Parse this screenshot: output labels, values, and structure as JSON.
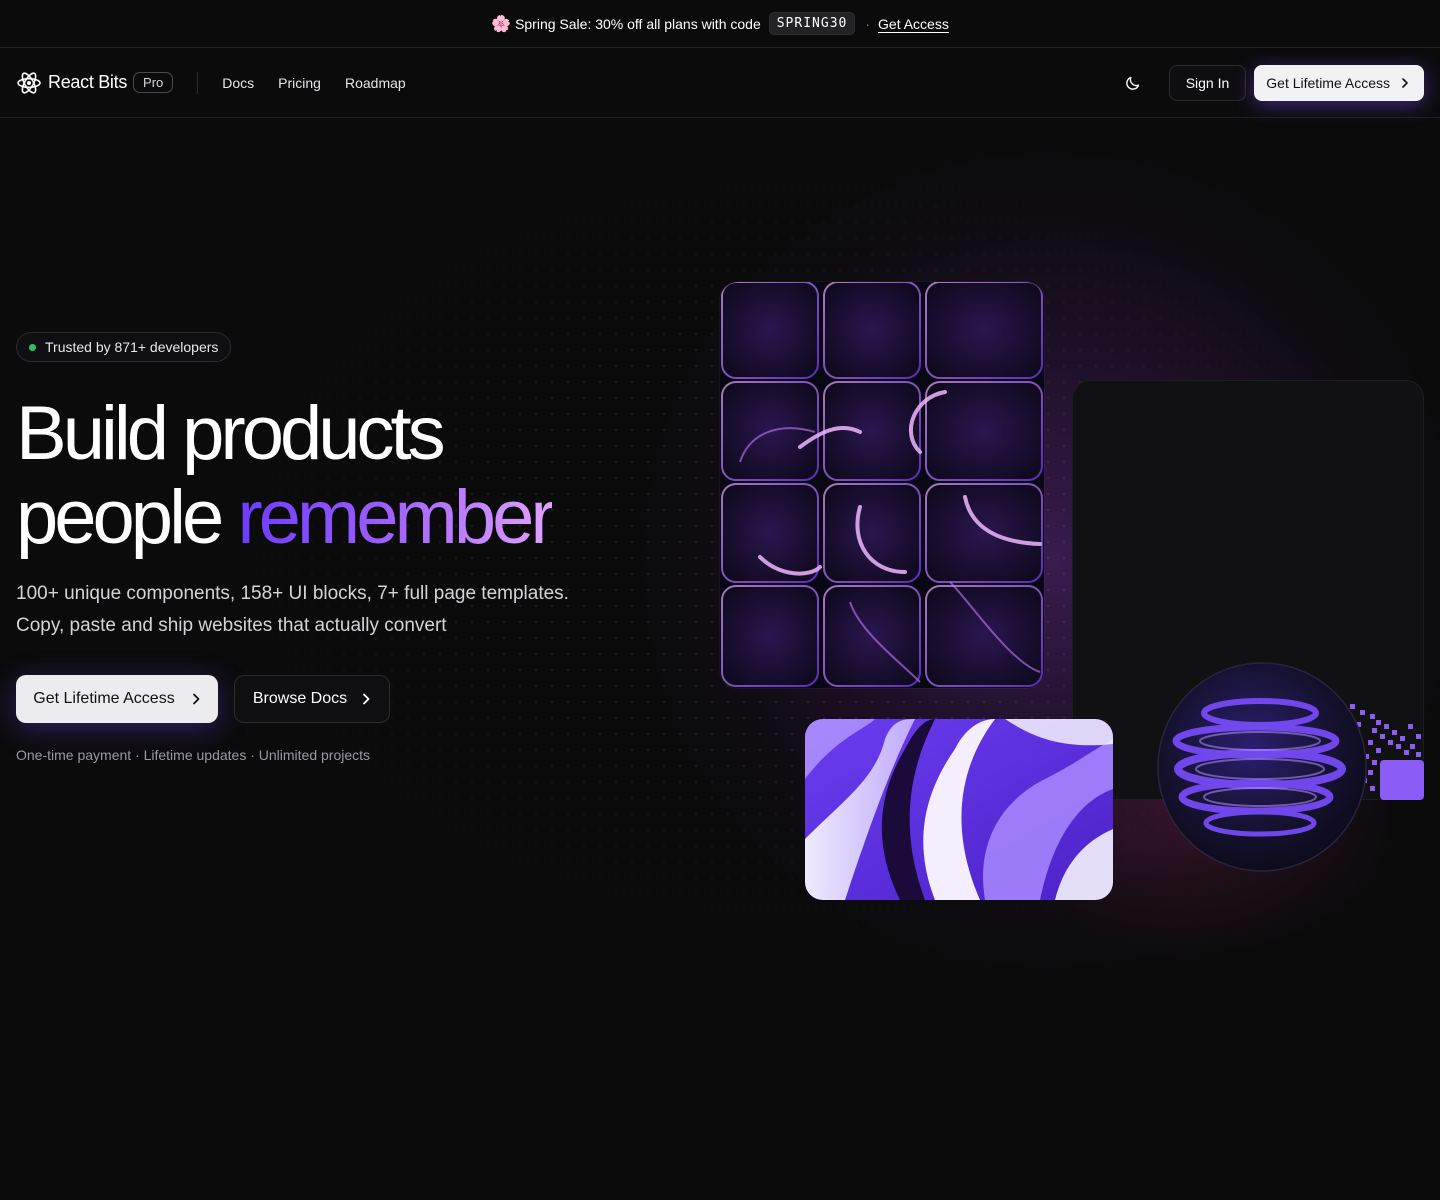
{
  "announcement": {
    "emoji": "🌸",
    "text": "Spring Sale: 30% off all plans with code",
    "code": "SPRING30",
    "separator": "·",
    "link": "Get Access"
  },
  "nav": {
    "brand": "React Bits",
    "badge": "Pro",
    "links": [
      "Docs",
      "Pricing",
      "Roadmap"
    ],
    "sign_in": "Sign In",
    "cta": "Get Lifetime Access"
  },
  "hero": {
    "trusted": "Trusted by 871+ developers",
    "headline_line1": "Build products",
    "headline_plain": "people",
    "headline_accent": "remember",
    "subtext_line1": "100+ unique components, 158+ UI blocks, 7+ full page templates.",
    "subtext_line2": "Copy, paste and ship websites that actually convert",
    "primary_button": "Get Lifetime Access",
    "secondary_button": "Browse Docs",
    "footnote": "One-time payment · Lifetime updates · Unlimited projects"
  },
  "colors": {
    "background": "#0b0b0c",
    "accent_start": "#6d3bff",
    "accent_end": "#e0a2ff",
    "status_dot": "#22c55e"
  },
  "icons": {
    "logo": "react-atom-icon",
    "theme": "moon-icon",
    "arrow": "chevron-right-icon"
  }
}
